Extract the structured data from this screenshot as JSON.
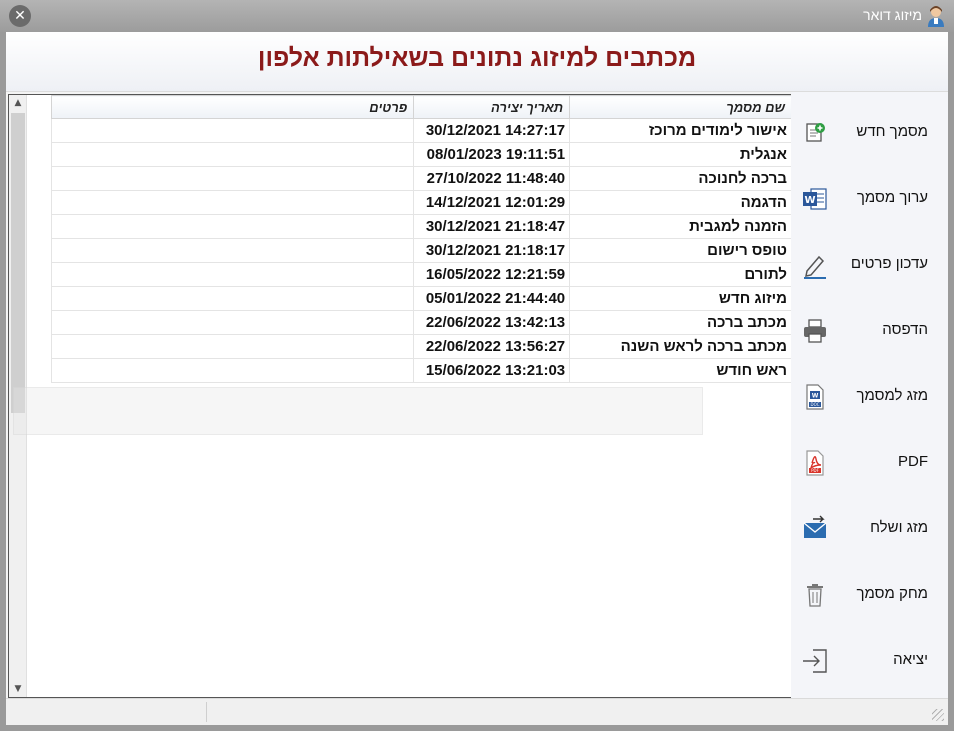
{
  "window": {
    "title": "מיזוג דואר",
    "close_glyph": "✕"
  },
  "page_title": "מכתבים למיזוג נתונים בשאילתות אלפון",
  "side_buttons": [
    {
      "label": "מסמך חדש",
      "icon": "new-document-icon"
    },
    {
      "label": "ערוך מסמך",
      "icon": "word-icon"
    },
    {
      "label": "עדכון פרטים",
      "icon": "pen-icon"
    },
    {
      "label": "הדפסה",
      "icon": "printer-icon"
    },
    {
      "label": "מזג למסמך",
      "icon": "doc-file-icon"
    },
    {
      "label": "PDF",
      "icon": "pdf-icon"
    },
    {
      "label": "מזג ושלח",
      "icon": "envelope-send-icon"
    },
    {
      "label": "מחק מסמך",
      "icon": "trash-icon"
    },
    {
      "label": "יציאה",
      "icon": "exit-icon"
    }
  ],
  "table": {
    "columns": [
      "שם מסמך",
      "תאריך יצירה",
      "פרטים"
    ],
    "rows": [
      {
        "name": "אישור לימודים מרוכז",
        "date": "30/12/2021 14:27:17",
        "details": ""
      },
      {
        "name": "אנגלית",
        "date": "08/01/2023 19:11:51",
        "details": ""
      },
      {
        "name": "ברכה לחנוכה",
        "date": "27/10/2022 11:48:40",
        "details": ""
      },
      {
        "name": "הדגמה",
        "date": "14/12/2021 12:01:29",
        "details": ""
      },
      {
        "name": "הזמנה למגבית",
        "date": "30/12/2021 21:18:47",
        "details": ""
      },
      {
        "name": "טופס רישום",
        "date": "30/12/2021 21:18:17",
        "details": ""
      },
      {
        "name": "לתורם",
        "date": "16/05/2022 12:21:59",
        "details": ""
      },
      {
        "name": "מיזוג חדש",
        "date": "05/01/2022 21:44:40",
        "details": ""
      },
      {
        "name": "מכתב ברכה",
        "date": "22/06/2022 13:42:13",
        "details": ""
      },
      {
        "name": "מכתב ברכה לראש השנה",
        "date": "22/06/2022 13:56:27",
        "details": ""
      },
      {
        "name": "ראש חודש",
        "date": "15/06/2022 13:21:03",
        "details": ""
      }
    ]
  },
  "colors": {
    "title": "#8b1a1a",
    "word_blue": "#2b579a",
    "pdf_red": "#d9342b"
  }
}
